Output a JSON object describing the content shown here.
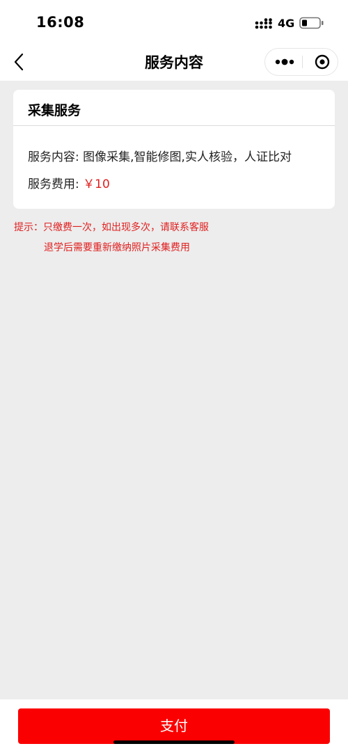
{
  "status_bar": {
    "time": "16:08",
    "network": "4G",
    "signal_icon": "signal-bars-icon",
    "battery_icon": "battery-low-icon"
  },
  "nav": {
    "title": "服务内容",
    "back_icon": "chevron-left-icon",
    "more_icon": "more-dots-icon",
    "close_icon": "target-close-icon"
  },
  "card": {
    "title": "采集服务",
    "content_label": "服务内容:",
    "content_value": "图像采集,智能修图,实人核验，人证比对",
    "fee_label": "服务费用:",
    "fee_value": "￥10"
  },
  "hint": {
    "line1": "提示：只缴费一次，如出现多次，请联系客服",
    "line2": "退学后需要重新缴纳照片采集费用"
  },
  "bottom": {
    "pay_label": "支付"
  },
  "colors": {
    "accent": "#fb0000",
    "hint_red": "#e02020",
    "background": "#ededed"
  }
}
